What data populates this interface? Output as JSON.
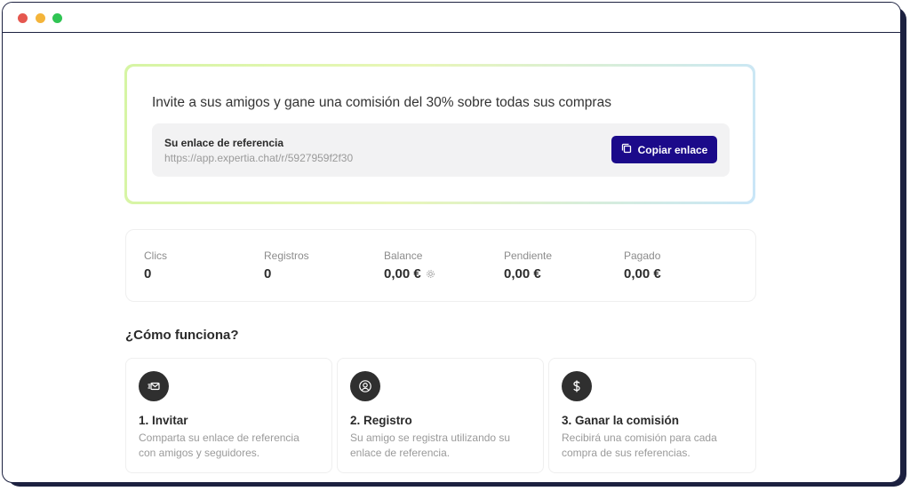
{
  "referral": {
    "headline": "Invite a sus amigos y gane una comisión del 30% sobre todas sus compras",
    "link_label": "Su enlace de referencia",
    "link_url": "https://app.expertia.chat/r/5927959f2f30",
    "copy_button": "Copiar enlace",
    "copy_icon": "copy-icon"
  },
  "stats": [
    {
      "label": "Clics",
      "value": "0"
    },
    {
      "label": "Registros",
      "value": "0"
    },
    {
      "label": "Balance",
      "value": "0,00 €",
      "icon": "gear-icon"
    },
    {
      "label": "Pendiente",
      "value": "0,00 €"
    },
    {
      "label": "Pagado",
      "value": "0,00 €"
    }
  ],
  "how_it_works": {
    "title": "¿Cómo funciona?",
    "steps": [
      {
        "icon": "mail-icon",
        "title": "1. Invitar",
        "description": "Comparta su enlace de referencia con amigos y seguidores."
      },
      {
        "icon": "user-circle-icon",
        "title": "2. Registro",
        "description": "Su amigo se registra utilizando su enlace de referencia."
      },
      {
        "icon": "dollar-icon",
        "title": "3. Ganar la comisión",
        "description": "Recibirá una comisión para cada compra de sus referencias."
      }
    ]
  },
  "colors": {
    "accent": "#1b0a8a",
    "card_gradient_start": "#d6f5a4",
    "card_gradient_end": "#c9e6f8"
  }
}
